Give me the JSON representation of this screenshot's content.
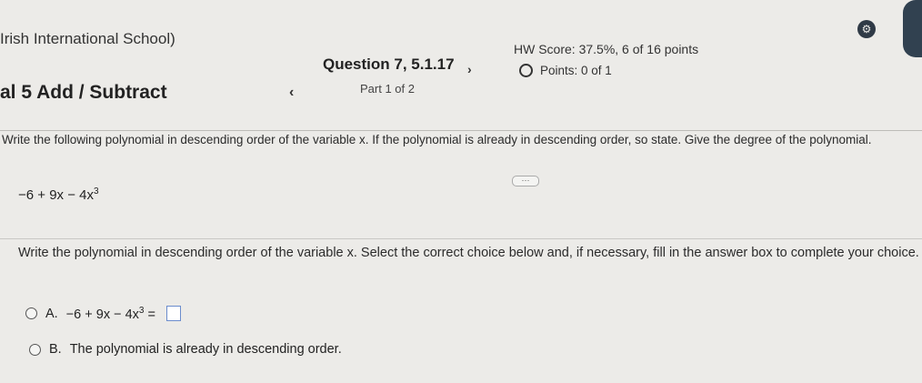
{
  "header": {
    "school": "Irish International School)",
    "chapter": "al 5 Add / Subtract",
    "prev_icon": "‹",
    "next_icon": "›",
    "question": "Question 7, 5.1.17",
    "part": "Part 1 of 2",
    "hw_score": "HW Score: 37.5%, 6 of 16 points",
    "points": "Points: 0 of 1"
  },
  "problem": {
    "prompt": "Write the following polynomial in descending order of the variable x. If the polynomial is already in descending order, so state. Give the degree of the polynomial.",
    "expression": "−6 + 9x − 4x",
    "exponent": "3",
    "more_button": "···"
  },
  "answer": {
    "instruction": "Write the polynomial in descending order of the variable x. Select the correct choice below and, if necessary, fill in the answer box to complete your choice.",
    "option_a_letter": "A.",
    "option_a_expr": "−6 + 9x − 4x",
    "option_a_exp": "3",
    "option_a_eq": " =",
    "option_b_letter": "B.",
    "option_b_text": "The polynomial is already in descending order."
  },
  "icons": {
    "settings": "gear-icon",
    "points_status": "circle-icon"
  }
}
